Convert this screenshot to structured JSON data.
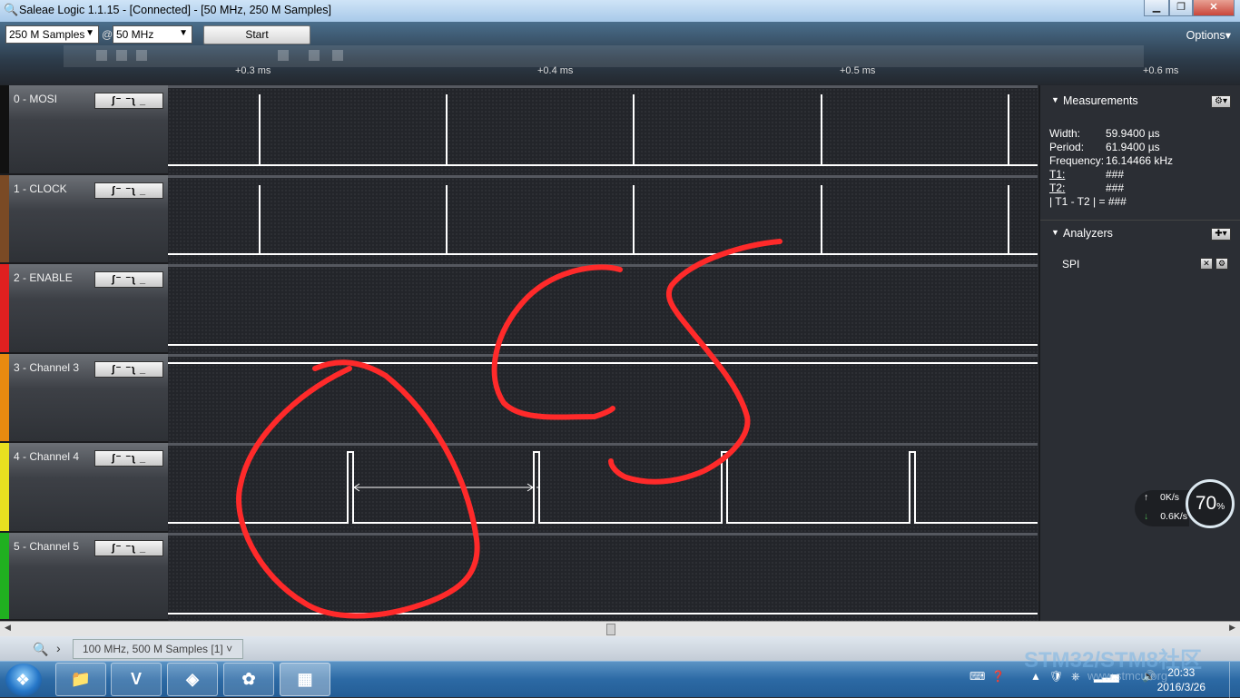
{
  "window": {
    "title": "Saleae Logic 1.1.15 - [Connected] - [50 MHz, 250 M Samples]",
    "min_label": "▁",
    "max_label": "❐",
    "close_label": "✕"
  },
  "toolbar": {
    "samples": "250 M Samples",
    "at": "@",
    "rate": "50 MHz",
    "start_label": "Start",
    "options_label": "Options▾"
  },
  "timeline": {
    "ticks": [
      "+0.3 ms",
      "+0.4 ms",
      "+0.5 ms",
      "+0.6 ms"
    ]
  },
  "channels": [
    {
      "name": "0 - MOSI",
      "color": "#111111"
    },
    {
      "name": "1 - CLOCK",
      "color": "#7a4a25"
    },
    {
      "name": "2 - ENABLE",
      "color": "#e02020"
    },
    {
      "name": "3 - Channel 3",
      "color": "#e88a10"
    },
    {
      "name": "4 - Channel 4",
      "color": "#e8e020"
    },
    {
      "name": "5 - Channel 5",
      "color": "#20b020"
    }
  ],
  "trigger_label": "ʃ⁻ ⁻ʅ _",
  "measurements": {
    "title": "Measurements",
    "rows": [
      {
        "k": "Width:",
        "v": "59.9400 µs"
      },
      {
        "k": "Period:",
        "v": "61.9400 µs"
      },
      {
        "k": "Frequency:",
        "v": "16.14466 kHz"
      },
      {
        "k": "T1:",
        "v": "###"
      },
      {
        "k": "T2:",
        "v": "###"
      },
      {
        "k": "| T1 - T2 | =",
        "v": "###"
      }
    ]
  },
  "analyzers": {
    "title": "Analyzers",
    "items": [
      "SPI"
    ]
  },
  "network": {
    "up": "0K/s",
    "down": "0.6K/s",
    "percent": "70",
    "percent_unit": "%"
  },
  "bottom": {
    "tab_label": "100 MHz, 500 M Samples [1]  ˅"
  },
  "watermark": {
    "line1": "STM32/STM8社区",
    "line2": "www.stmcu.org"
  },
  "clock": {
    "time": "20:33",
    "date": "2016/3/26"
  }
}
